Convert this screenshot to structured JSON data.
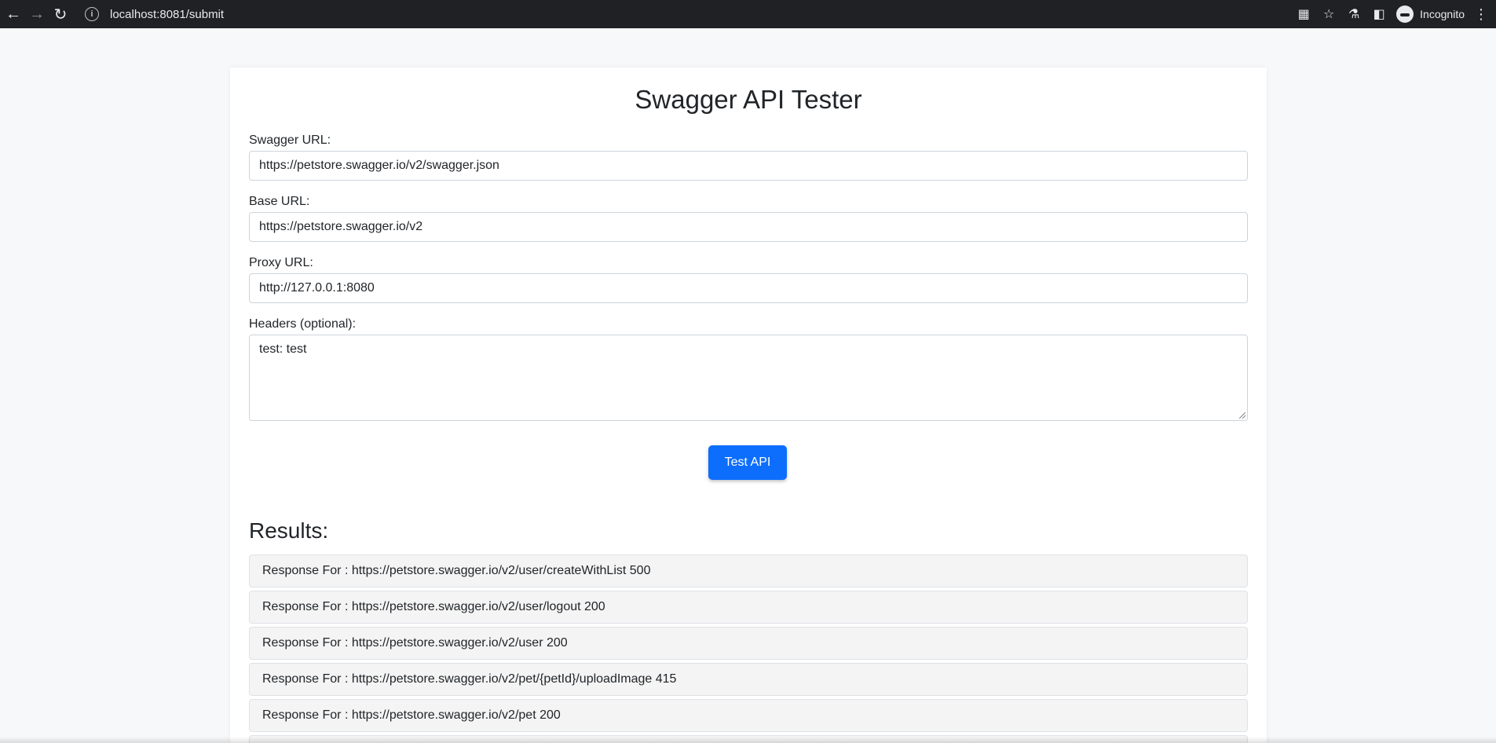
{
  "browser": {
    "url": "localhost:8081/submit",
    "profile_label": "Incognito"
  },
  "page": {
    "title": "Swagger API Tester",
    "swagger_url_label": "Swagger URL:",
    "swagger_url_value": "https://petstore.swagger.io/v2/swagger.json",
    "base_url_label": "Base URL:",
    "base_url_value": "https://petstore.swagger.io/v2",
    "proxy_url_label": "Proxy URL:",
    "proxy_url_value": "http://127.0.0.1:8080",
    "headers_label": "Headers (optional):",
    "headers_value": "test: test",
    "test_button_label": "Test API",
    "results_title": "Results:",
    "results": [
      "Response For : https://petstore.swagger.io/v2/user/createWithList 500",
      "Response For : https://petstore.swagger.io/v2/user/logout 200",
      "Response For : https://petstore.swagger.io/v2/user 200",
      "Response For : https://petstore.swagger.io/v2/pet/{petId}/uploadImage 415",
      "Response For : https://petstore.swagger.io/v2/pet 200"
    ]
  },
  "colors": {
    "primary_button": "#0d6efd",
    "page_background": "#f7f8fa",
    "result_row_background": "#f4f4f4"
  }
}
